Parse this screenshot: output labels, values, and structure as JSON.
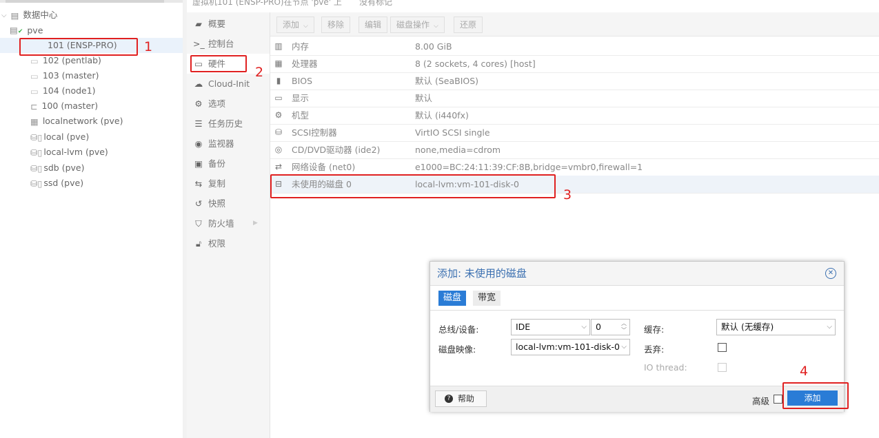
{
  "header": {
    "breadcrumb": "虚拟机101 (ENSP-PRO)在节点 'pve' 上",
    "notes_label": "没有标记"
  },
  "tree": {
    "items": [
      {
        "label": "数据中心",
        "icon": "datacenter-icon"
      },
      {
        "label": "pve",
        "icon": "server-icon"
      },
      {
        "label": "101 (ENSP-PRO)",
        "icon": "vm-icon"
      },
      {
        "label": "102 (pentlab)",
        "icon": "vm-icon"
      },
      {
        "label": "103 (master)",
        "icon": "vm-icon"
      },
      {
        "label": "104 (node1)",
        "icon": "vm-icon"
      },
      {
        "label": "100 (master)",
        "icon": "template-icon"
      },
      {
        "label": "localnetwork (pve)",
        "icon": "network-icon"
      },
      {
        "label": "local (pve)",
        "icon": "storage-icon"
      },
      {
        "label": "local-lvm (pve)",
        "icon": "storage-icon"
      },
      {
        "label": "sdb (pve)",
        "icon": "storage-icon"
      },
      {
        "label": "ssd (pve)",
        "icon": "storage-icon"
      }
    ]
  },
  "nav": {
    "items": [
      {
        "label": "概要",
        "icon": "summary-icon"
      },
      {
        "label": "控制台",
        "icon": "console-icon"
      },
      {
        "label": "硬件",
        "icon": "hardware-icon"
      },
      {
        "label": "Cloud-Init",
        "icon": "cloud-icon"
      },
      {
        "label": "选项",
        "icon": "gear-icon"
      },
      {
        "label": "任务历史",
        "icon": "list-icon"
      },
      {
        "label": "监视器",
        "icon": "eye-icon"
      },
      {
        "label": "备份",
        "icon": "floppy-icon"
      },
      {
        "label": "复制",
        "icon": "replicate-icon"
      },
      {
        "label": "快照",
        "icon": "history-icon"
      },
      {
        "label": "防火墙",
        "icon": "shield-icon"
      },
      {
        "label": "权限",
        "icon": "unlock-icon"
      }
    ]
  },
  "toolbar": {
    "add": "添加",
    "remove": "移除",
    "edit": "编辑",
    "disk_action": "磁盘操作",
    "revert": "还原"
  },
  "hardware": {
    "rows": [
      {
        "key": "内存",
        "value": "8.00 GiB",
        "icon": "memory-icon"
      },
      {
        "key": "处理器",
        "value": "8 (2 sockets, 4 cores) [host]",
        "icon": "cpu-icon"
      },
      {
        "key": "BIOS",
        "value": "默认 (SeaBIOS)",
        "icon": "bios-icon"
      },
      {
        "key": "显示",
        "value": "默认",
        "icon": "display-icon"
      },
      {
        "key": "机型",
        "value": "默认 (i440fx)",
        "icon": "machine-icon"
      },
      {
        "key": "SCSI控制器",
        "value": "VirtIO SCSI single",
        "icon": "database-icon"
      },
      {
        "key": "CD/DVD驱动器 (ide2)",
        "value": "none,media=cdrom",
        "icon": "cdrom-icon"
      },
      {
        "key": "网络设备 (net0)",
        "value": "e1000=BC:24:11:39:CF:8B,bridge=vmbr0,firewall=1",
        "icon": "exchange-icon"
      },
      {
        "key": "未使用的磁盘 0",
        "value": "local-lvm:vm-101-disk-0",
        "icon": "hdd-icon"
      }
    ]
  },
  "annotations": {
    "n1": "1",
    "n2": "2",
    "n3": "3",
    "n4": "4"
  },
  "dialog": {
    "title": "添加: 未使用的磁盘",
    "tabs": [
      "磁盘",
      "带宽"
    ],
    "bus_label": "总线/设备:",
    "bus_value": "IDE",
    "bus_index": "0",
    "image_label": "磁盘映像:",
    "image_value": "local-lvm:vm-101-disk-0",
    "cache_label": "缓存:",
    "cache_value": "默认 (无缓存)",
    "discard_label": "丢弃:",
    "discard_checked": false,
    "iothread_label": "IO thread:",
    "iothread_checked": false,
    "help_label": "帮助",
    "advanced_label": "高级",
    "advanced_checked": false,
    "add_label": "添加"
  }
}
